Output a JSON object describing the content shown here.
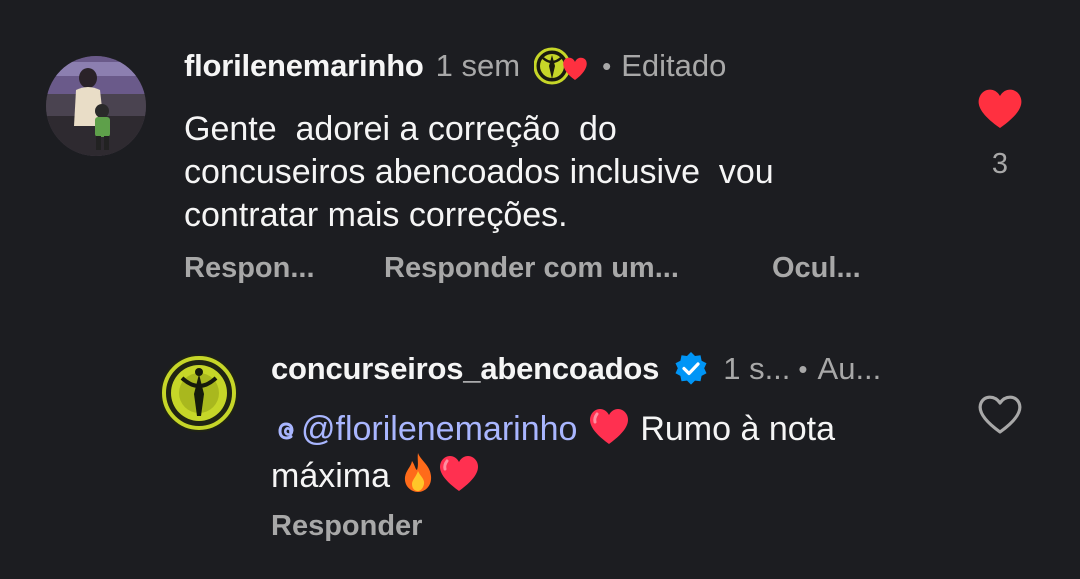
{
  "comment": {
    "username": "florilenemarinho",
    "time": "1 sem",
    "edited": "Editado",
    "separator": "•",
    "text": "Gente  adorei a correção  do\nconcuseiros abencoados inclusive  vou\ncontratar mais correções.",
    "actions": {
      "reply": "Respon...",
      "reply_with": "Responder com um...",
      "hide": "Ocul..."
    },
    "like_count": "3",
    "liked": true,
    "avatar_icon": "user-photo-avatar",
    "creator_badge_icon": "creator-liked-heart-badge"
  },
  "reply": {
    "username": "concurseiros_abencoados",
    "verified": true,
    "time": "1 s...",
    "author": "Au...",
    "separator": "•",
    "mention": "@florilenemarinho",
    "text_part1": " Rumo à nota",
    "text_part2": "máxima ",
    "actions": {
      "reply": "Responder"
    },
    "liked": false,
    "avatar_icon": "brand-logo-avatar"
  },
  "colors": {
    "background": "#1c1d21",
    "text": "#f5f5f5",
    "muted": "#a8a8a8",
    "like_red": "#ff3040",
    "mention": "#a9b6ff",
    "verified_blue": "#0095f6",
    "brand_green": "#c6d628"
  }
}
